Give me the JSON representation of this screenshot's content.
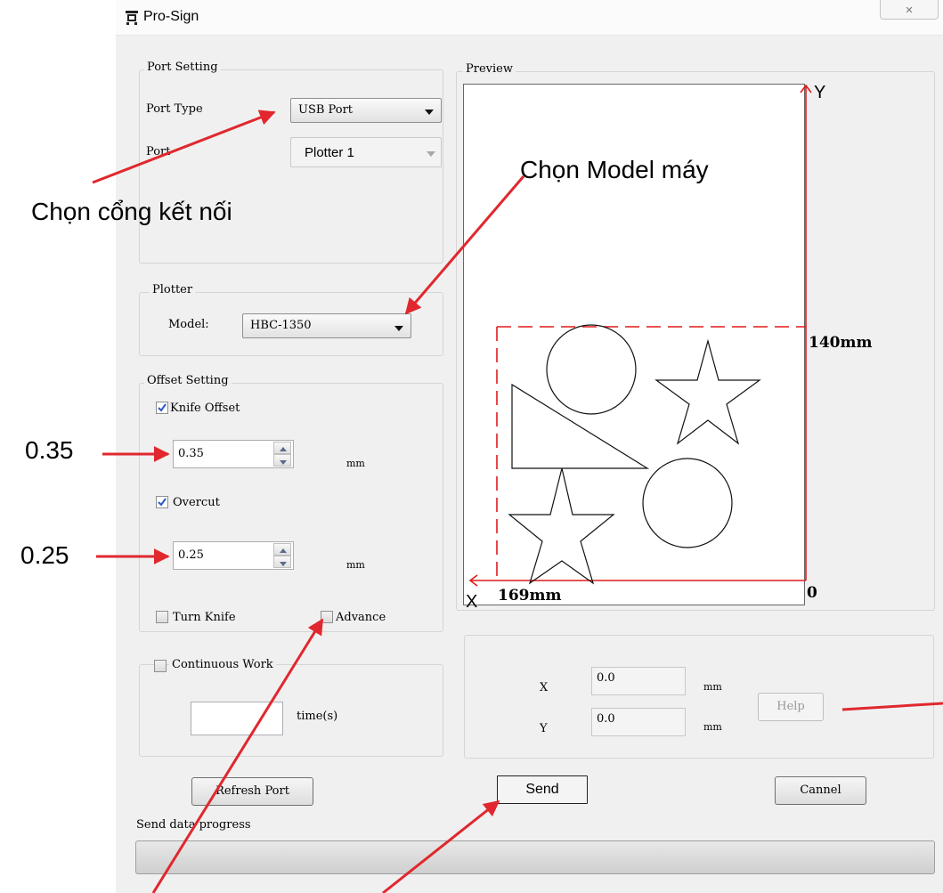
{
  "window": {
    "title": "Pro-Sign",
    "close_glyph": "✕"
  },
  "port_setting": {
    "legend": "Port Setting",
    "port_type_label": "Port Type",
    "port_type_value": "USB Port",
    "port_label": "Port",
    "port_value": "Plotter 1"
  },
  "plotter": {
    "legend": "Plotter",
    "model_label": "Model:",
    "model_value": "HBC-1350"
  },
  "offset_setting": {
    "legend": "Offset Setting",
    "knife_offset_label": "Knife Offset",
    "knife_offset_checked": true,
    "knife_offset_value": "0.35",
    "knife_offset_unit": "mm",
    "overcut_label": "Overcut",
    "overcut_checked": true,
    "overcut_value": "0.25",
    "overcut_unit": "mm",
    "turn_knife_label": "Turn Knife",
    "advance_label": "Advance"
  },
  "continuous": {
    "label": "Continuous Work",
    "time_value": "",
    "time_unit": "time(s)"
  },
  "preview": {
    "legend": "Preview",
    "y_axis_label": "Y",
    "x_axis_label": "X",
    "height_label": "140mm",
    "width_label": "169mm",
    "origin_label": "0"
  },
  "position": {
    "x_label": "X",
    "x_value": "0.0",
    "x_unit": "mm",
    "y_label": "Y",
    "y_value": "0.0",
    "y_unit": "mm",
    "help_label": "Help"
  },
  "buttons": {
    "refresh": "Refresh Port",
    "send": "Send",
    "cancel": "Cannel"
  },
  "progress": {
    "label": "Send data progress",
    "fraction": 0
  },
  "annotations": {
    "port": "Chọn cổng kết nối",
    "model": "Chọn Model máy",
    "offset_value": "0.35",
    "overcut_value": "0.25"
  },
  "colors": {
    "arrow": "#e0282e",
    "guide": "#d4141a"
  }
}
